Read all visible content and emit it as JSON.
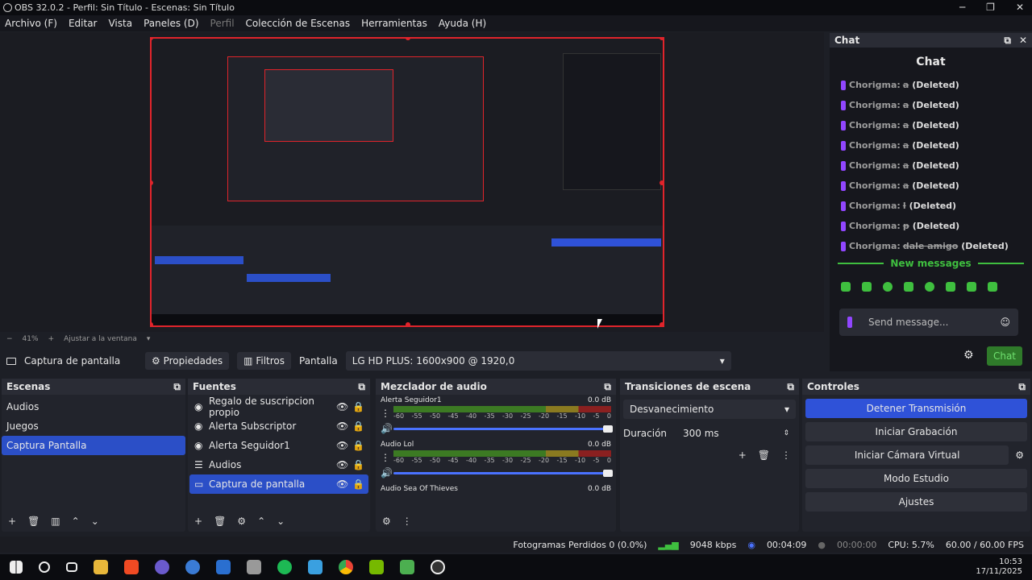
{
  "window": {
    "title": "OBS 32.0.2 - Perfil: Sin Título - Escenas: Sin Título",
    "minimize": "─",
    "maximize": "❐",
    "close": "✕"
  },
  "menu": [
    "Archivo (F)",
    "Editar",
    "Vista",
    "Paneles (D)",
    "Perfil",
    "Colección de Escenas",
    "Herramientas",
    "Ayuda (H)"
  ],
  "zoom": {
    "value": "41%",
    "fit_label": "Ajustar a la ventana"
  },
  "source_bar": {
    "source_name": "Captura de pantalla",
    "properties_label": "Propiedades",
    "filters_label": "Filtros",
    "display_label": "Pantalla",
    "display_value": "LG HD PLUS: 1600x900 @ 1920,0"
  },
  "chat": {
    "dock_title": "Chat",
    "title": "Chat",
    "messages": [
      {
        "user": "Chorigma:",
        "text": "a",
        "status": "(Deleted)"
      },
      {
        "user": "Chorigma:",
        "text": "a",
        "status": "(Deleted)"
      },
      {
        "user": "Chorigma:",
        "text": "a",
        "status": "(Deleted)"
      },
      {
        "user": "Chorigma:",
        "text": "a",
        "status": "(Deleted)"
      },
      {
        "user": "Chorigma:",
        "text": "a",
        "status": "(Deleted)"
      },
      {
        "user": "Chorigma:",
        "text": "a",
        "status": "(Deleted)"
      },
      {
        "user": "Chorigma:",
        "text": "l",
        "status": "(Deleted)"
      },
      {
        "user": "Chorigma:",
        "text": "p",
        "status": "(Deleted)"
      },
      {
        "user": "Chorigma:",
        "text": "dale amigo",
        "status": "(Deleted)"
      }
    ],
    "new_messages": "New messages",
    "input_placeholder": "Send message...",
    "send_button": "Chat"
  },
  "scenes": {
    "title": "Escenas",
    "items": [
      "Audios",
      "Juegos",
      "Captura Pantalla"
    ],
    "selected": 2
  },
  "sources": {
    "title": "Fuentes",
    "items": [
      "Regalo de suscripcion propio",
      "Alerta Subscriptor",
      "Alerta Seguidor1",
      "Audios",
      "Captura de pantalla"
    ],
    "selected": 4
  },
  "mixer": {
    "title": "Mezclador de audio",
    "channels": [
      {
        "name": "Alerta Seguidor1",
        "db": "0.0 dB"
      },
      {
        "name": "Audio Lol",
        "db": "0.0 dB"
      },
      {
        "name": "Audio Sea Of Thieves",
        "db": "0.0 dB"
      }
    ],
    "ticks": [
      "-60",
      "-55",
      "-50",
      "-45",
      "-40",
      "-35",
      "-30",
      "-25",
      "-20",
      "-15",
      "-10",
      "-5",
      "0"
    ]
  },
  "transitions": {
    "title": "Transiciones de escena",
    "type": "Desvanecimiento",
    "duration_label": "Duración",
    "duration_value": "300 ms"
  },
  "controls": {
    "title": "Controles",
    "stop_stream": "Detener Transmisión",
    "start_recording": "Iniciar Grabación",
    "virtual_cam": "Iniciar Cámara Virtual",
    "studio_mode": "Modo Estudio",
    "settings": "Ajustes"
  },
  "status": {
    "dropped": "Fotogramas Perdidos 0 (0.0%)",
    "bitrate": "9048 kbps",
    "stream_time": "00:04:09",
    "rec_time": "00:00:00",
    "cpu": "CPU: 5.7%",
    "fps": "60.00 / 60.00 FPS"
  },
  "taskbar": {
    "time": "10:53",
    "date": "17/11/2025"
  },
  "colors": {
    "accent": "#2f52d8",
    "preview_border": "#e0242b",
    "chat_green": "#3fbf3f"
  }
}
